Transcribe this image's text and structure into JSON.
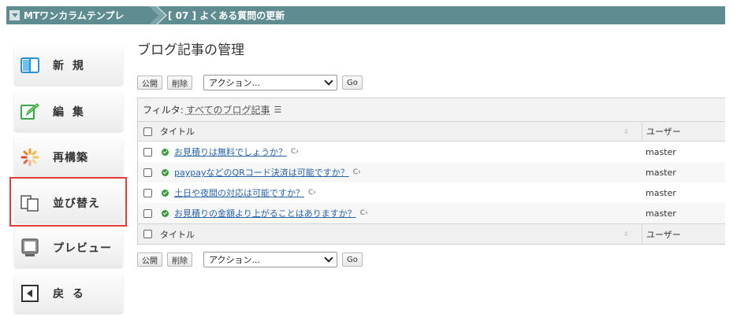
{
  "breadcrumb": {
    "site": "MTワンカラムテンプレ",
    "page": "[ 07 ] よくある質問の更新"
  },
  "sidebar": {
    "items": [
      {
        "label": "新 規",
        "icon": "window-icon"
      },
      {
        "label": "編 集",
        "icon": "edit-pen-icon"
      },
      {
        "label": "再構築",
        "icon": "loading-spinner-icon"
      },
      {
        "label": "並び替え",
        "icon": "sort-pages-icon"
      },
      {
        "label": "プレビュー",
        "icon": "preview-monitor-icon"
      },
      {
        "label": "戻 る",
        "icon": "back-arrow-icon"
      }
    ]
  },
  "main": {
    "title": "ブログ記事の管理",
    "actions": {
      "publish": "公開",
      "delete": "削除",
      "action_select": "アクション...",
      "go": "Go"
    },
    "filter": {
      "label": "フィルタ:",
      "value": "すべてのブログ記事"
    },
    "table": {
      "col_title": "タイトル",
      "col_user": "ユーザー",
      "rows": [
        {
          "title": "お見積りは無料でしょうか？",
          "user": "master"
        },
        {
          "title": "paypayなどのQRコード決済は可能ですか？",
          "user": "master"
        },
        {
          "title": "土日や夜間の対応は可能ですか？",
          "user": "master"
        },
        {
          "title": "お見積りの金額より上がることはありますか？",
          "user": "master"
        }
      ]
    }
  },
  "colors": {
    "topbar": "#5e8c91",
    "link": "#2a64a8",
    "status_green": "#3c9a3c",
    "highlight_red": "#e03c3c"
  }
}
